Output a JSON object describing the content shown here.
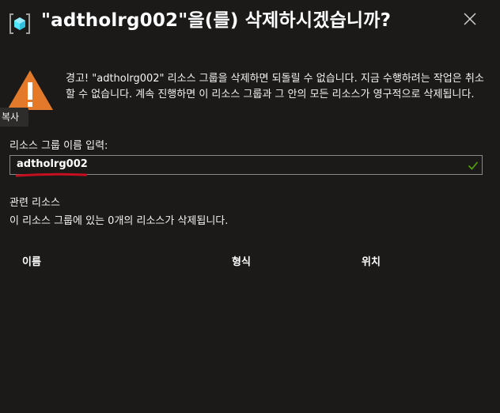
{
  "dialog": {
    "title": "\"adtholrg002\"을(를) 삭제하시겠습니까?",
    "icons": {
      "title": "resource-group-icon",
      "close": "close-icon",
      "warning": "warning-icon",
      "valid": "checkmark-icon"
    }
  },
  "warning": {
    "text": "경고! \"adtholrg002\" 리소스 그룹을 삭제하면 되돌릴 수 없습니다. 지금 수행하려는 작업은 취소할 수 없습니다. 계속 진행하면 이 리소스 그룹과 그 안의 모든 리소스가 영구적으로 삭제됩니다."
  },
  "tooltip": {
    "text": "복사"
  },
  "confirm_input": {
    "label": "리소스 그룹 이름 입력:",
    "value": "adtholrg002"
  },
  "related": {
    "title": "관련 리소스",
    "description": "이 리소스 그룹에 있는 0개의 리소스가 삭제됩니다."
  },
  "table": {
    "columns": [
      "이름",
      "형식",
      "위치"
    ],
    "rows": []
  },
  "colors": {
    "background": "#1b1a19",
    "warning": "#e3792a",
    "valid": "#57a300",
    "annotation": "#c50f1f"
  }
}
